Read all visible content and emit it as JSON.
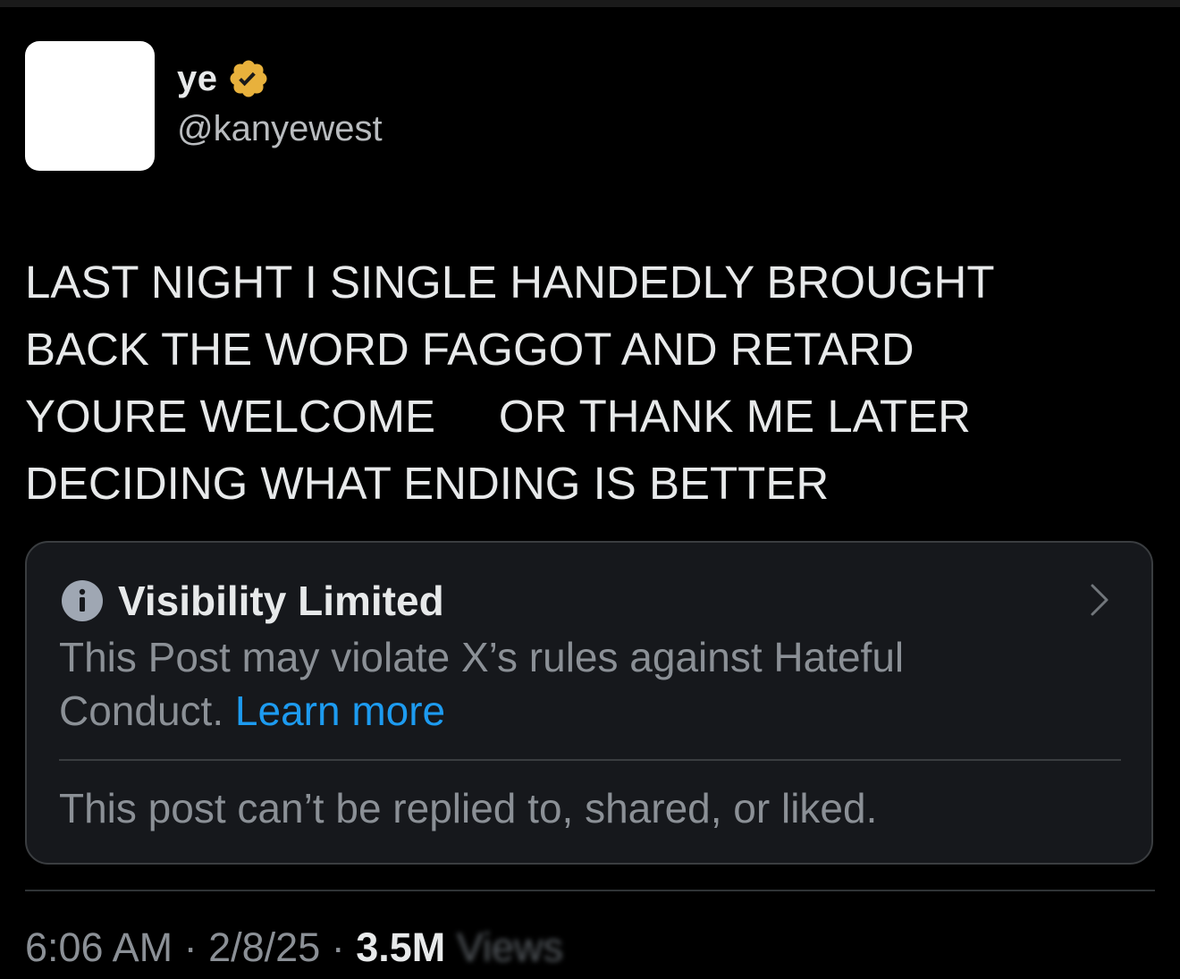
{
  "author": {
    "display_name": "ye",
    "handle": "@kanyewest"
  },
  "post": {
    "lines": [
      "LAST NIGHT I SINGLE HANDEDLY BROUGHT",
      "BACK THE WORD FAGGOT AND RETARD",
      "YOURE WELCOME     OR THANK ME LATER",
      "DECIDING WHAT ENDING IS BETTER"
    ]
  },
  "notice": {
    "title": "Visibility Limited",
    "body": "This Post may violate X’s rules against Hateful Conduct.",
    "learn_more": "Learn more",
    "footer": "This post can’t be replied to, shared, or liked."
  },
  "meta": {
    "time": "6:06 AM",
    "separator": " · ",
    "date": "2/8/25",
    "views": "3.5M",
    "views_label": " Views"
  },
  "icons": {
    "verified": "verified-badge-icon",
    "info": "info-icon",
    "chevron": "chevron-right-icon"
  },
  "colors": {
    "background": "#000000",
    "text_primary": "#e7e9ea",
    "text_secondary": "#8b9096",
    "link": "#1d9bf0",
    "verified_gold": "#e8b13c",
    "card_bg": "#16181c",
    "border": "#3a3d40"
  }
}
